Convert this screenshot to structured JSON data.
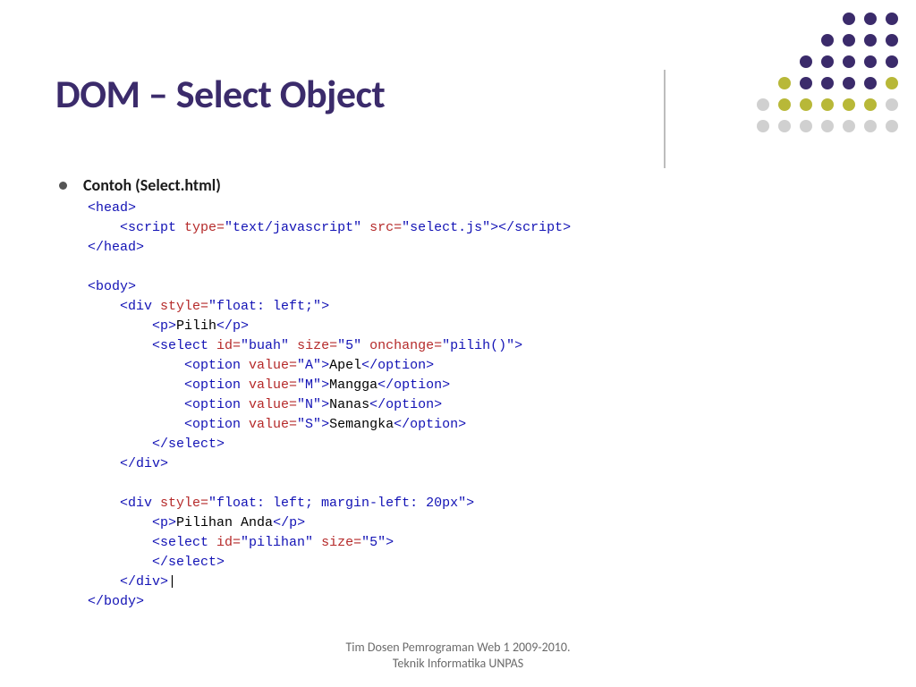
{
  "title": "DOM – Select Object",
  "bullet": "Contoh (Select.html)",
  "code": {
    "l1": "<head>",
    "l2a": "    <script ",
    "l2b": "type=",
    "l2c": "\"text/javascript\"",
    "l2d": " src=",
    "l2e": "\"select.js\"",
    "l2f": "></scr",
    "l2g": "ipt>",
    "l3": "</head>",
    "l4": "",
    "l5": "<body>",
    "l6a": "    <div ",
    "l6b": "style=",
    "l6c": "\"float: left;\"",
    "l6d": ">",
    "l7a": "        <p>",
    "l7b": "Pilih",
    "l7c": "</p>",
    "l8a": "        <select ",
    "l8b": "id=",
    "l8c": "\"buah\"",
    "l8d": " size=",
    "l8e": "\"5\"",
    "l8f": " onchange=",
    "l8g": "\"pilih()\"",
    "l8h": ">",
    "l9a": "            <option ",
    "l9b": "value=",
    "l9c": "\"A\"",
    "l9d": ">",
    "l9e": "Apel",
    "l9f": "</option>",
    "l10a": "            <option ",
    "l10b": "value=",
    "l10c": "\"M\"",
    "l10d": ">",
    "l10e": "Mangga",
    "l10f": "</option>",
    "l11a": "            <option ",
    "l11b": "value=",
    "l11c": "\"N\"",
    "l11d": ">",
    "l11e": "Nanas",
    "l11f": "</option>",
    "l12a": "            <option ",
    "l12b": "value=",
    "l12c": "\"S\"",
    "l12d": ">",
    "l12e": "Semangka",
    "l12f": "</option>",
    "l13": "        </select>",
    "l14": "    </div>",
    "l15": "",
    "l16a": "    <div ",
    "l16b": "style=",
    "l16c": "\"float: left; margin-left: 20px\"",
    "l16d": ">",
    "l17a": "        <p>",
    "l17b": "Pilihan Anda",
    "l17c": "</p>",
    "l18a": "        <select ",
    "l18b": "id=",
    "l18c": "\"pilihan\"",
    "l18d": " size=",
    "l18e": "\"5\"",
    "l18f": ">",
    "l19": "        </select>",
    "l20": "    </div>",
    "cur": "|",
    "l21": "</body>"
  },
  "footer1": "Tim Dosen Pemrograman Web 1 2009-2010.",
  "footer2": "Teknik Informatika UNPAS",
  "dotgrid_colors": [
    [
      "empty",
      "empty",
      "empty",
      "empty",
      "dark",
      "dark",
      "dark"
    ],
    [
      "empty",
      "empty",
      "empty",
      "dark",
      "dark",
      "dark",
      "dark"
    ],
    [
      "empty",
      "empty",
      "dark",
      "dark",
      "dark",
      "dark",
      "dark"
    ],
    [
      "empty",
      "olive",
      "dark",
      "dark",
      "dark",
      "dark",
      "olive"
    ],
    [
      "grey",
      "olive",
      "olive",
      "olive",
      "olive",
      "olive",
      "grey"
    ],
    [
      "grey",
      "grey",
      "grey",
      "grey",
      "grey",
      "grey",
      "grey"
    ],
    [
      "empty",
      "empty",
      "empty",
      "empty",
      "empty",
      "empty",
      "empty"
    ]
  ]
}
